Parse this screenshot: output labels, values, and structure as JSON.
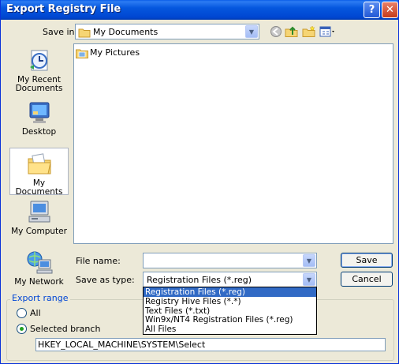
{
  "window": {
    "title": "Export Registry File",
    "help_button": "?",
    "close_button": "✕"
  },
  "save_in": {
    "label": "Save in:",
    "value": "My Documents"
  },
  "places": [
    {
      "label": "My Recent Documents",
      "icon": "recent-documents-icon"
    },
    {
      "label": "Desktop",
      "icon": "desktop-icon"
    },
    {
      "label": "My Documents",
      "icon": "my-documents-icon",
      "selected": true
    },
    {
      "label": "My Computer",
      "icon": "my-computer-icon"
    },
    {
      "label": "My Network",
      "icon": "my-network-icon"
    }
  ],
  "files": [
    {
      "name": "My Pictures",
      "icon": "folder-icon"
    }
  ],
  "file_name": {
    "label": "File name:",
    "value": ""
  },
  "save_as_type": {
    "label": "Save as type:",
    "value": "Registration Files (*.reg)",
    "options": [
      "Registration Files (*.reg)",
      "Registry Hive Files (*.*)",
      "Text Files (*.txt)",
      "Win9x/NT4 Registration Files (*.reg)",
      "All Files"
    ],
    "selected_index": 0
  },
  "buttons": {
    "save": "Save",
    "cancel": "Cancel"
  },
  "export_range": {
    "title": "Export range",
    "all_label": "All",
    "selected_branch_label": "Selected branch",
    "selected": "selected_branch",
    "branch_path": "HKEY_LOCAL_MACHINE\\SYSTEM\\Select"
  }
}
